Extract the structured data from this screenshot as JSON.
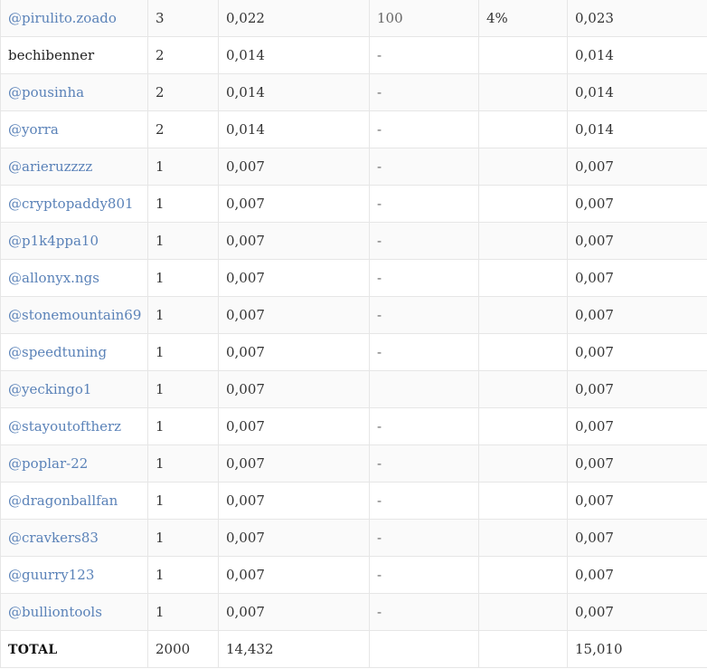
{
  "rows": [
    {
      "user": "@pirulito.zoado",
      "linked": true,
      "qty": "3",
      "value": "0,022",
      "bonus": "100",
      "percent": "4%",
      "total": "0,023"
    },
    {
      "user": "bechibenner",
      "linked": false,
      "qty": "2",
      "value": "0,014",
      "bonus": "-",
      "percent": "",
      "total": "0,014"
    },
    {
      "user": "@pousinha",
      "linked": true,
      "qty": "2",
      "value": "0,014",
      "bonus": "-",
      "percent": "",
      "total": "0,014"
    },
    {
      "user": "@yorra",
      "linked": true,
      "qty": "2",
      "value": "0,014",
      "bonus": "-",
      "percent": "",
      "total": "0,014"
    },
    {
      "user": "@arieruzzzz",
      "linked": true,
      "qty": "1",
      "value": "0,007",
      "bonus": "-",
      "percent": "",
      "total": "0,007"
    },
    {
      "user": "@cryptopaddy801",
      "linked": true,
      "qty": "1",
      "value": "0,007",
      "bonus": "-",
      "percent": "",
      "total": "0,007"
    },
    {
      "user": "@p1k4ppa10",
      "linked": true,
      "qty": "1",
      "value": "0,007",
      "bonus": "-",
      "percent": "",
      "total": "0,007"
    },
    {
      "user": "@allonyx.ngs",
      "linked": true,
      "qty": "1",
      "value": "0,007",
      "bonus": "-",
      "percent": "",
      "total": "0,007"
    },
    {
      "user": "@stonemountain69",
      "linked": true,
      "qty": "1",
      "value": "0,007",
      "bonus": "-",
      "percent": "",
      "total": "0,007"
    },
    {
      "user": "@speedtuning",
      "linked": true,
      "qty": "1",
      "value": "0,007",
      "bonus": "-",
      "percent": "",
      "total": "0,007"
    },
    {
      "user": "@yeckingo1",
      "linked": true,
      "qty": "1",
      "value": "0,007",
      "bonus": "",
      "percent": "",
      "total": "0,007"
    },
    {
      "user": "@stayoutoftherz",
      "linked": true,
      "qty": "1",
      "value": "0,007",
      "bonus": "-",
      "percent": "",
      "total": "0,007"
    },
    {
      "user": "@poplar-22",
      "linked": true,
      "qty": "1",
      "value": "0,007",
      "bonus": "-",
      "percent": "",
      "total": "0,007"
    },
    {
      "user": "@dragonballfan",
      "linked": true,
      "qty": "1",
      "value": "0,007",
      "bonus": "-",
      "percent": "",
      "total": "0,007"
    },
    {
      "user": "@cravkers83",
      "linked": true,
      "qty": "1",
      "value": "0,007",
      "bonus": "-",
      "percent": "",
      "total": "0,007"
    },
    {
      "user": "@guurry123",
      "linked": true,
      "qty": "1",
      "value": "0,007",
      "bonus": "-",
      "percent": "",
      "total": "0,007"
    },
    {
      "user": "@bulliontools",
      "linked": true,
      "qty": "1",
      "value": "0,007",
      "bonus": "-",
      "percent": "",
      "total": "0,007"
    }
  ],
  "totals": {
    "label": "TOTAL",
    "qty": "2000",
    "value": "14,432",
    "bonus": "",
    "percent": "",
    "total": "15,010"
  },
  "colors": {
    "link": "#5a82b8",
    "text": "#333333",
    "border": "#e6e6e6",
    "stripe": "#fafafa"
  }
}
